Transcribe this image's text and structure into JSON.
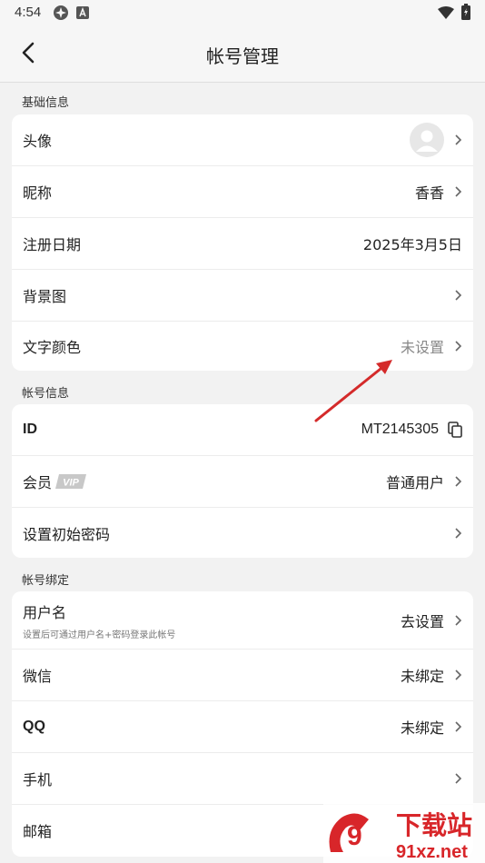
{
  "status_bar": {
    "time": "4:54"
  },
  "header": {
    "title": "帐号管理"
  },
  "sections": {
    "basic": {
      "label": "基础信息",
      "avatar_label": "头像",
      "nickname_label": "昵称",
      "nickname_value": "香香",
      "register_label": "注册日期",
      "register_value": "2025年3月5日",
      "background_label": "背景图",
      "text_color_label": "文字颜色",
      "text_color_value": "未设置"
    },
    "account": {
      "label": "帐号信息",
      "id_label": "ID",
      "id_value": "MT2145305",
      "member_label": "会员",
      "member_badge": "VIP",
      "member_value": "普通用户",
      "password_label": "设置初始密码"
    },
    "binding": {
      "label": "帐号绑定",
      "username_label": "用户名",
      "username_hint": "设置后可通过用户名+密码登录此帐号",
      "username_value": "去设置",
      "wechat_label": "微信",
      "wechat_value": "未绑定",
      "qq_label": "QQ",
      "qq_value": "未绑定",
      "phone_label": "手机",
      "email_label": "邮箱"
    }
  },
  "watermark": {
    "text": "下载站",
    "domain": "91xz.net",
    "brand_color": "#d8262a"
  }
}
